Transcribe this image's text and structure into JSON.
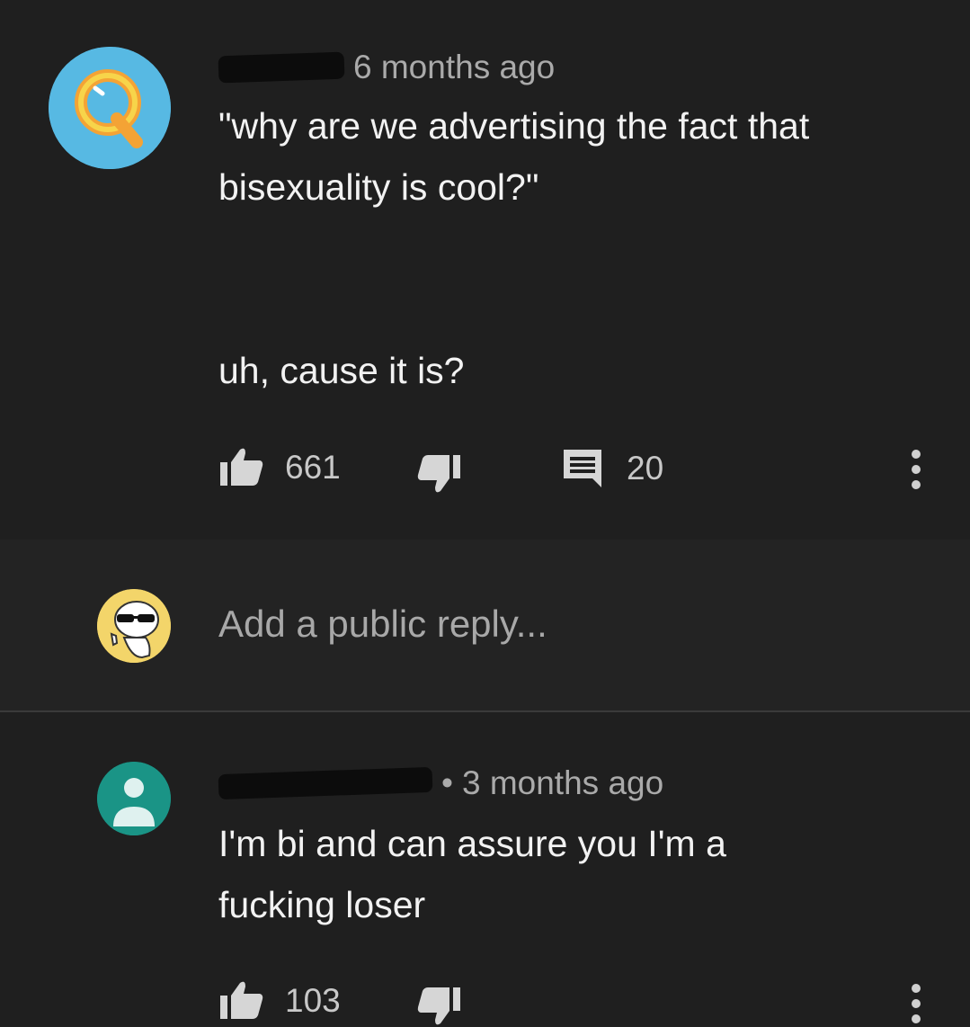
{
  "comment1": {
    "time": "6 months ago",
    "text": "\"why are we advertising the fact that\nbisexuality is cool?\"\n\n\nuh, cause it is?",
    "likes": "661",
    "replies_count": "20"
  },
  "reply_box": {
    "placeholder": "Add a public reply..."
  },
  "comment2": {
    "time": "3 months ago",
    "text": "I'm bi and can assure you I'm a\nfucking loser",
    "likes": "103"
  },
  "icons": {
    "like": "thumbs-up-icon",
    "dislike": "thumbs-down-icon",
    "reply": "comment-icon",
    "more": "more-vert-icon"
  },
  "colors": {
    "background": "#1f1f1f",
    "reply_area": "#232323",
    "text": "#f2f2f2",
    "secondary_text": "#aaaaaa",
    "avatar_blue": "#57b9e3",
    "avatar_yellow": "#f3d56a",
    "avatar_teal": "#1a9486"
  }
}
